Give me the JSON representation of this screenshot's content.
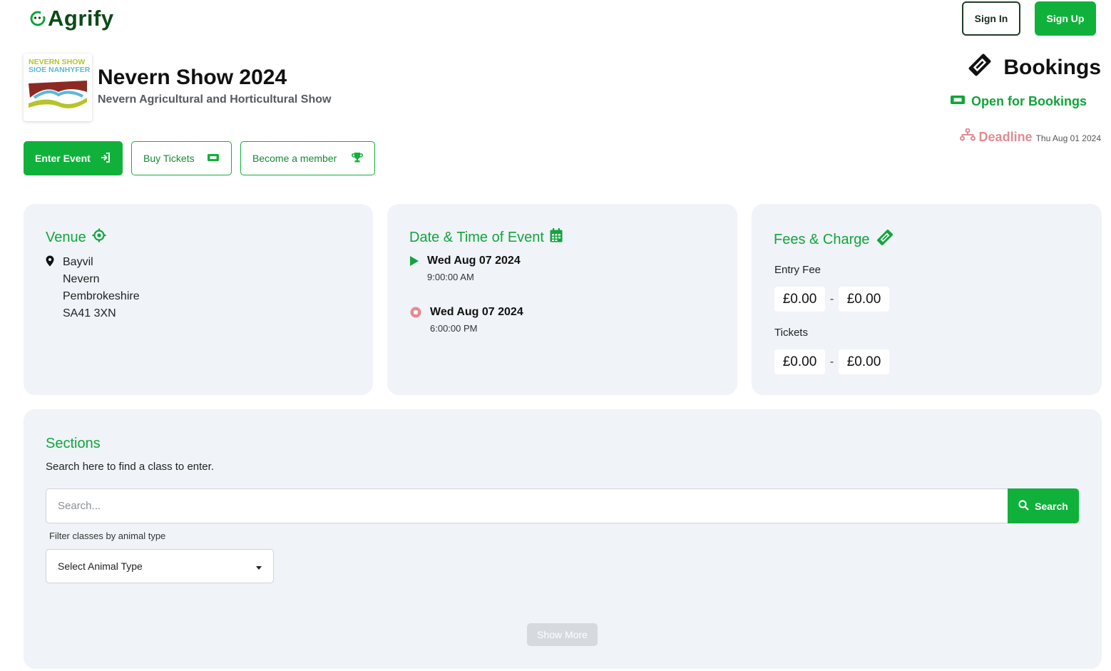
{
  "header": {
    "brand": "Agrify",
    "sign_in_label": "Sign In",
    "sign_up_label": "Sign Up"
  },
  "event": {
    "logo_line1": "NEVERN SHOW",
    "logo_line2": "SIOE NANHYFER",
    "title": "Nevern Show 2024",
    "subtitle": "Nevern Agricultural and Horticultural Show"
  },
  "actions": {
    "enter_event": "Enter Event",
    "buy_tickets": "Buy Tickets",
    "become_member": "Become a member"
  },
  "bookings": {
    "title": "Bookings",
    "status": "Open for Bookings",
    "deadline_label": "Deadline",
    "deadline_date": "Thu Aug 01 2024"
  },
  "venue": {
    "title": "Venue",
    "lines": [
      "Bayvil",
      "Nevern",
      "Pembrokeshire",
      "SA41 3XN"
    ]
  },
  "datetime": {
    "title": "Date & Time of Event",
    "start_date": "Wed Aug 07 2024",
    "start_time": "9:00:00 AM",
    "end_date": "Wed Aug 07 2024",
    "end_time": "6:00:00 PM"
  },
  "fees": {
    "title": "Fees & Charge",
    "entry_fee_label": "Entry Fee",
    "entry_min": "£0.00",
    "entry_max": "£0.00",
    "tickets_label": "Tickets",
    "tickets_min": "£0.00",
    "tickets_max": "£0.00",
    "separator": "-"
  },
  "sections": {
    "title": "Sections",
    "description": "Search here to find a class to enter.",
    "search_placeholder": "Search...",
    "search_button": "Search",
    "filter_label": "Filter classes by animal type",
    "select_value": "Select Animal Type",
    "show_more": "Show More"
  },
  "colors": {
    "accent_green": "#10b13b",
    "title_green": "#12a53c",
    "deadline_red": "#e08c91",
    "card_bg": "#f0f3f8"
  },
  "icons": [
    "horseshoe-logo-icon",
    "sign-in-icon",
    "ticket-icon",
    "trophy-icon",
    "ticket-diagonal-icon",
    "route-icon",
    "crosshair-icon",
    "map-pin-icon",
    "calendar-icon",
    "play-icon",
    "stop-circle-icon",
    "search-icon",
    "caret-down-icon"
  ]
}
